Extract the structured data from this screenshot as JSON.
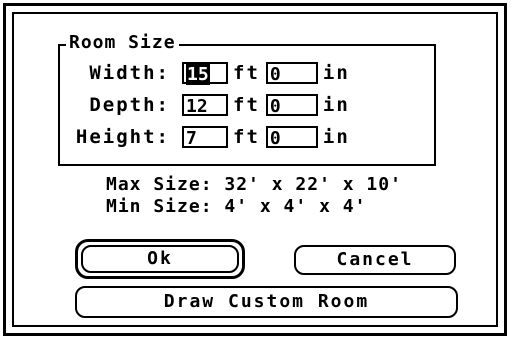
{
  "room_size": {
    "title": "Room Size",
    "rows": [
      {
        "label": "Width:",
        "ft_value": "15",
        "ft_unit": "ft",
        "in_value": "0",
        "in_unit": "in"
      },
      {
        "label": "Depth:",
        "ft_value": "12",
        "ft_unit": "ft",
        "in_value": "0",
        "in_unit": "in"
      },
      {
        "label": "Height:",
        "ft_value": "7",
        "ft_unit": "ft",
        "in_value": "0",
        "in_unit": "in"
      }
    ]
  },
  "limits": {
    "max": "Max Size: 32' x 22' x 10'",
    "min": "Min Size: 4' x 4' x 4'"
  },
  "buttons": {
    "ok": "Ok",
    "cancel": "Cancel",
    "custom": "Draw Custom Room"
  }
}
